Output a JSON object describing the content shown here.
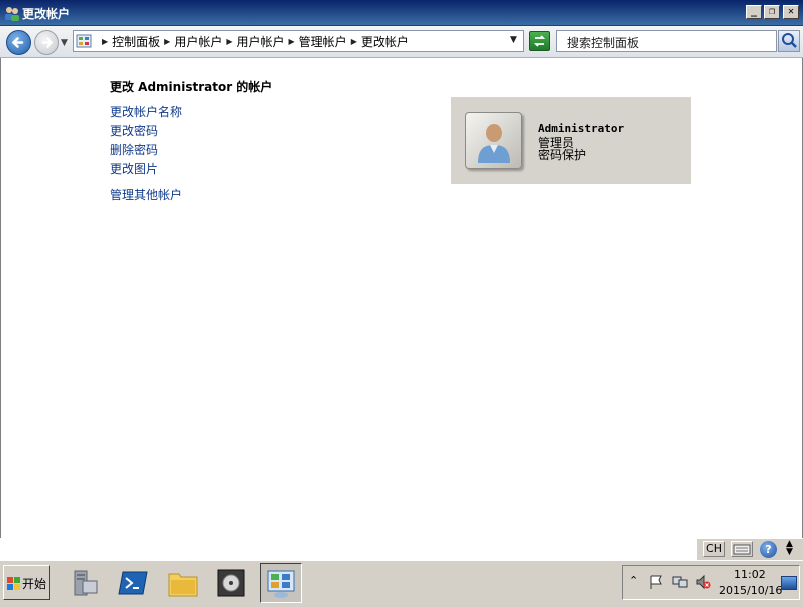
{
  "window": {
    "title": "更改帐户"
  },
  "breadcrumb": {
    "items": [
      "控制面板",
      "用户帐户",
      "用户帐户",
      "管理帐户",
      "更改帐户"
    ]
  },
  "search": {
    "placeholder": "搜索控制面板"
  },
  "main": {
    "heading": "更改 Administrator 的帐户",
    "links": [
      "更改帐户名称",
      "更改密码",
      "删除密码",
      "更改图片"
    ],
    "other_link": "管理其他帐户"
  },
  "account": {
    "name": "Administrator",
    "role": "管理员",
    "status": "密码保护"
  },
  "language_bar": {
    "lang": "CH",
    "help": "?"
  },
  "taskbar": {
    "start_label": "开始",
    "clock_time": "11:02",
    "clock_date": "2015/10/16"
  },
  "colors": {
    "titlebar": "#0a246a",
    "link": "#0f3a8a",
    "panel": "#d6d3cc",
    "taskbar": "#d4d0c8"
  }
}
